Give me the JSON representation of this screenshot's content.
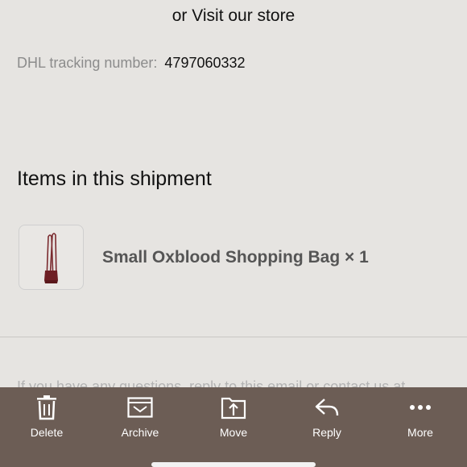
{
  "header": {
    "visit_store_text": "or Visit our store"
  },
  "tracking": {
    "label": "DHL tracking number:",
    "number": "4797060332"
  },
  "shipment": {
    "title": "Items in this shipment",
    "items": [
      {
        "name": "Small Oxblood Shopping Bag × 1",
        "image": "oxblood-bag"
      }
    ]
  },
  "footer": {
    "text": "If you have any questions, reply to this email or contact us at"
  },
  "toolbar": {
    "items": [
      {
        "label": "Delete",
        "icon": "trash-icon"
      },
      {
        "label": "Archive",
        "icon": "archive-icon"
      },
      {
        "label": "Move",
        "icon": "move-icon"
      },
      {
        "label": "Reply",
        "icon": "reply-icon"
      },
      {
        "label": "More",
        "icon": "more-icon"
      }
    ]
  },
  "colors": {
    "toolbar_bg": "#6c5d55",
    "page_bg": "#e6e4e1",
    "bag": "#6e1f24"
  }
}
